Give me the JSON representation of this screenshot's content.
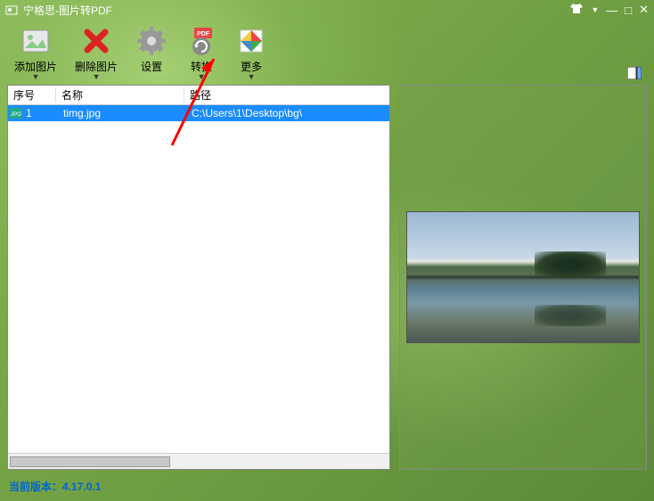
{
  "titlebar": {
    "title": "宁格思-图片转PDF"
  },
  "toolbar": {
    "add_label": "添加图片",
    "delete_label": "删除图片",
    "settings_label": "设置",
    "convert_label": "转换",
    "more_label": "更多"
  },
  "columns": {
    "num": "序号",
    "name": "名称",
    "path": "路径"
  },
  "rows": [
    {
      "num": "1",
      "name": "timg.jpg",
      "path": "C:\\Users\\1\\Desktop\\bg\\"
    }
  ],
  "status": {
    "version_text": "当前版本：4.17.0.1"
  }
}
